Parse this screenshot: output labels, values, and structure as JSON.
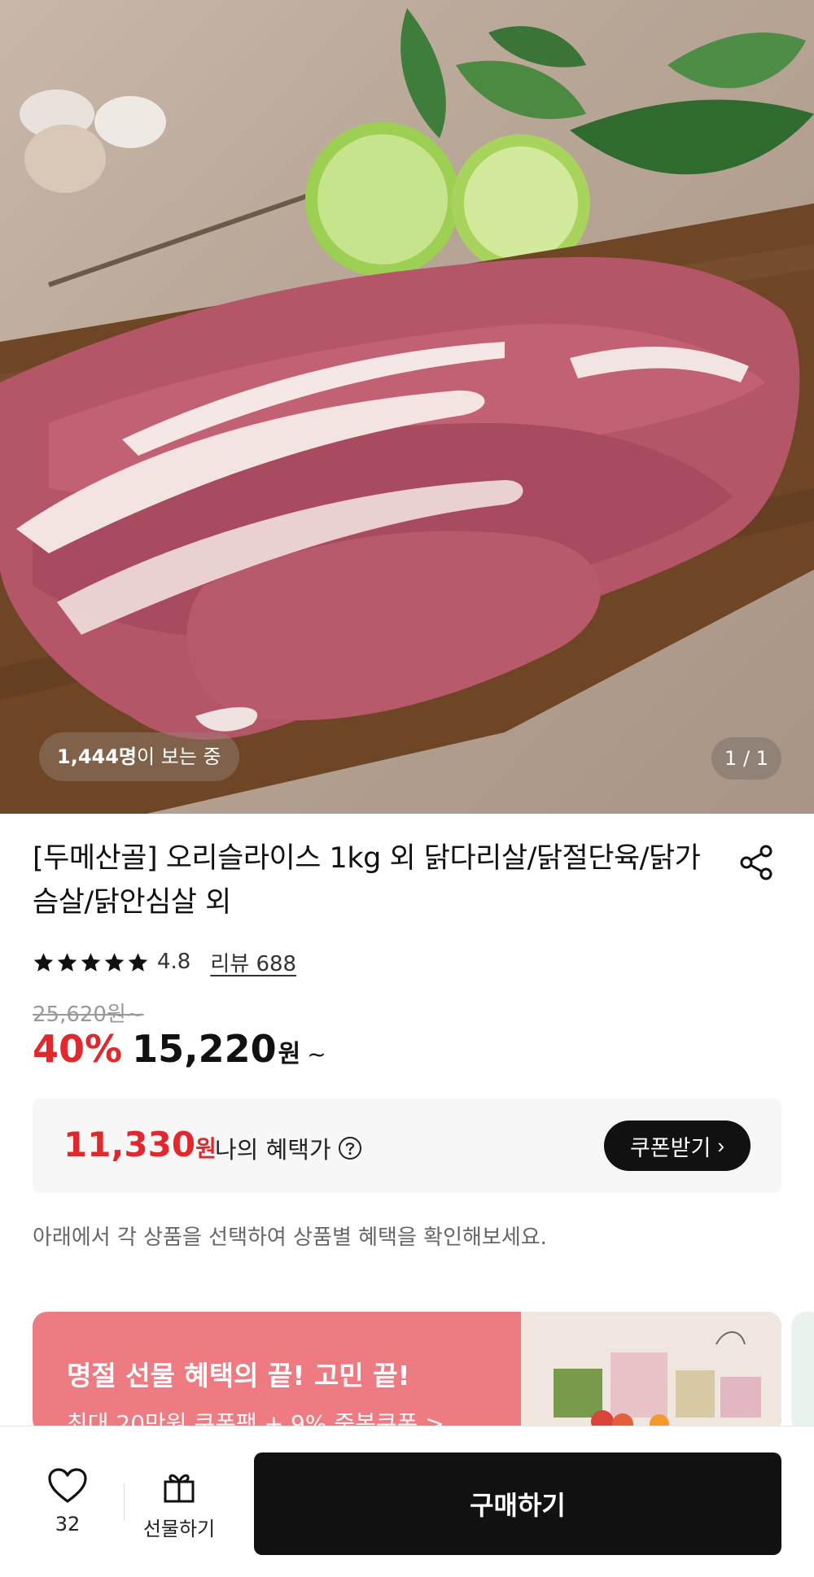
{
  "hero": {
    "viewer_count": "1,444명",
    "viewer_suffix": "이 보는 중",
    "pager": "1 / 1"
  },
  "product": {
    "title": "[두메산골] 오리슬라이스 1kg 외 닭다리살/닭절단육/닭가슴살/닭안심살 외",
    "rating": "4.8",
    "star_count": 5,
    "review_label": "리뷰 688",
    "original_price": "25,620원~",
    "discount": "40%",
    "sale_price": "15,220",
    "sale_unit": "원",
    "sale_suffix": "~"
  },
  "benefit": {
    "price": "11,330",
    "unit": "원",
    "label": "나의 혜택가",
    "coupon_button": "쿠폰받기"
  },
  "notice": "아래에서 각 상품을 선택하여 상품별 혜택을 확인해보세요.",
  "banner": {
    "title": "명절 선물 혜택의 끝! 고민 끝!",
    "subtitle": "최대 20만원 쿠폰팩 + 9% 중복쿠폰 >"
  },
  "bottom_bar": {
    "wish_count": "32",
    "gift_label": "선물하기",
    "buy_label": "구매하기"
  },
  "colors": {
    "accent_red": "#e2282c",
    "button_black": "#111111",
    "banner_pink": "#ef7b82"
  }
}
